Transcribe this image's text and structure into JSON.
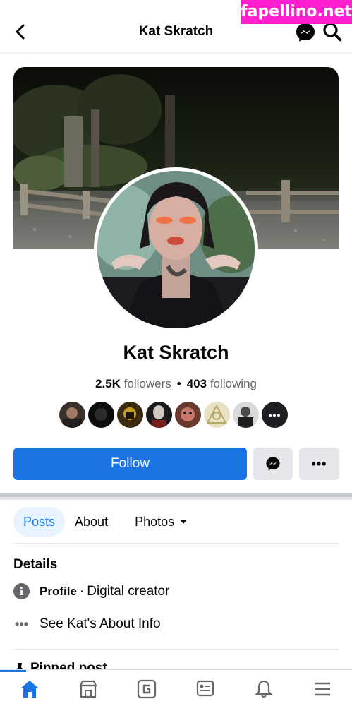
{
  "watermark": "fapellino.net",
  "header": {
    "title": "Kat Skratch",
    "back_icon": "back-arrow-icon",
    "messenger_icon": "messenger-icon",
    "search_icon": "search-icon"
  },
  "profile": {
    "name": "Kat Skratch",
    "followers_count": "2.5K",
    "followers_label": "followers",
    "separator": "•",
    "following_count": "403",
    "following_label": "following",
    "more_friends": "•••"
  },
  "actions": {
    "follow_label": "Follow",
    "messenger_icon": "messenger-icon",
    "more_label": "•••"
  },
  "tabs": [
    {
      "label": "Posts",
      "active": true
    },
    {
      "label": "About",
      "active": false
    },
    {
      "label": "Photos",
      "active": false
    }
  ],
  "details": {
    "title": "Details",
    "profile_label": "Profile",
    "profile_separator": "·",
    "profile_value": "Digital creator",
    "about_link": "See Kat's About Info"
  },
  "pinned": {
    "label": "Pinned post"
  },
  "bottom_nav": [
    {
      "icon": "home-icon",
      "active": true
    },
    {
      "icon": "marketplace-icon",
      "active": false
    },
    {
      "icon": "gaming-icon",
      "active": false
    },
    {
      "icon": "feeds-icon",
      "active": false
    },
    {
      "icon": "bell-icon",
      "active": false
    },
    {
      "icon": "menu-icon",
      "active": false
    }
  ],
  "colors": {
    "accent": "#1b74e4",
    "secondary_button": "#e4e6eb",
    "watermark": "#ff1fcf"
  }
}
